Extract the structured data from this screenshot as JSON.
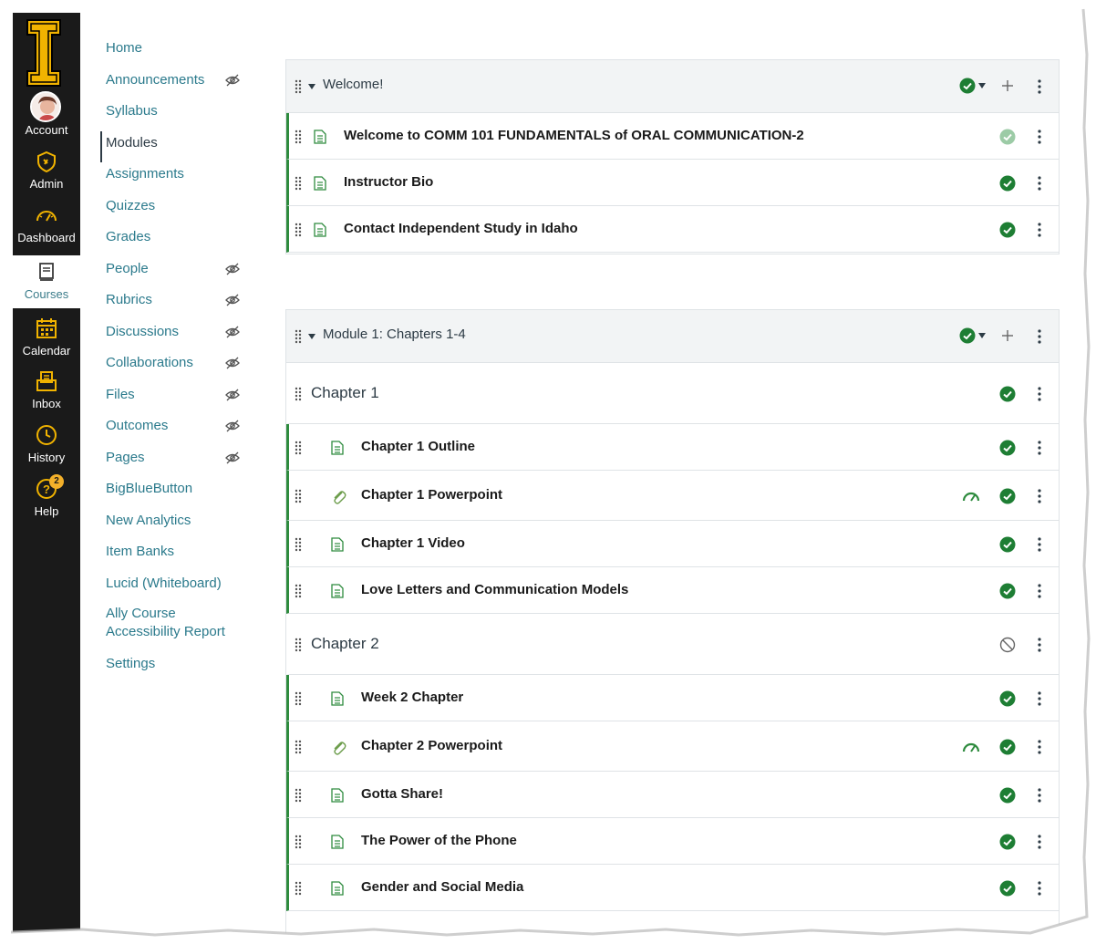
{
  "global_nav": {
    "items": [
      {
        "label": "Account",
        "icon": "account-avatar"
      },
      {
        "label": "Admin",
        "icon": "admin-shield-icon"
      },
      {
        "label": "Dashboard",
        "icon": "dashboard-icon"
      },
      {
        "label": "Courses",
        "icon": "courses-icon"
      },
      {
        "label": "Calendar",
        "icon": "calendar-icon"
      },
      {
        "label": "Inbox",
        "icon": "inbox-icon"
      },
      {
        "label": "History",
        "icon": "history-icon"
      },
      {
        "label": "Help",
        "icon": "help-icon",
        "badge": "2"
      }
    ],
    "active": "Courses"
  },
  "course_nav": {
    "items": [
      {
        "label": "Home",
        "hidden": false
      },
      {
        "label": "Announcements",
        "hidden": true
      },
      {
        "label": "Syllabus",
        "hidden": false
      },
      {
        "label": "Modules",
        "hidden": false,
        "active": true
      },
      {
        "label": "Assignments",
        "hidden": false
      },
      {
        "label": "Quizzes",
        "hidden": false
      },
      {
        "label": "Grades",
        "hidden": false
      },
      {
        "label": "People",
        "hidden": true
      },
      {
        "label": "Rubrics",
        "hidden": true
      },
      {
        "label": "Discussions",
        "hidden": true
      },
      {
        "label": "Collaborations",
        "hidden": true
      },
      {
        "label": "Files",
        "hidden": true
      },
      {
        "label": "Outcomes",
        "hidden": true
      },
      {
        "label": "Pages",
        "hidden": true
      },
      {
        "label": "BigBlueButton",
        "hidden": false
      },
      {
        "label": "New Analytics",
        "hidden": false
      },
      {
        "label": "Item Banks",
        "hidden": false
      },
      {
        "label": "Lucid (Whiteboard)",
        "hidden": false
      },
      {
        "label": "Ally Course Accessibility Report",
        "hidden": false
      },
      {
        "label": "Settings",
        "hidden": false
      }
    ]
  },
  "modules": [
    {
      "title": "Welcome!",
      "items": [
        {
          "title": "Welcome to COMM 101 FUNDAMENTALS of ORAL COMMUNICATION-2",
          "type": "page",
          "status": "published-faded"
        },
        {
          "title": "Instructor Bio",
          "type": "page",
          "status": "published"
        },
        {
          "title": "Contact Independent Study in Idaho",
          "type": "page",
          "status": "published"
        }
      ]
    },
    {
      "title": "Module 1: Chapters 1-4",
      "items": [
        {
          "title": "Chapter 1",
          "type": "subheader",
          "status": "published"
        },
        {
          "title": "Chapter 1 Outline",
          "type": "page",
          "status": "published"
        },
        {
          "title": "Chapter 1 Powerpoint",
          "type": "file",
          "status": "published"
        },
        {
          "title": "Chapter 1 Video",
          "type": "page",
          "status": "published"
        },
        {
          "title": "Love Letters and Communication Models",
          "type": "page",
          "status": "published"
        },
        {
          "title": "Chapter 2",
          "type": "subheader",
          "status": "unpublished"
        },
        {
          "title": "Week 2 Chapter",
          "type": "page",
          "status": "published"
        },
        {
          "title": "Chapter 2 Powerpoint",
          "type": "file",
          "status": "published"
        },
        {
          "title": "Gotta Share!",
          "type": "page",
          "status": "published"
        },
        {
          "title": "The Power of the Phone",
          "type": "page",
          "status": "published"
        },
        {
          "title": "Gender and Social Media",
          "type": "page",
          "status": "published"
        }
      ]
    }
  ],
  "colors": {
    "global_nav_bg": "#1a1a1a",
    "logo_gold": "#f1b300",
    "link": "#2b7a8c",
    "published_green": "#1e7e34",
    "module_border_green": "#2e8b3e"
  }
}
